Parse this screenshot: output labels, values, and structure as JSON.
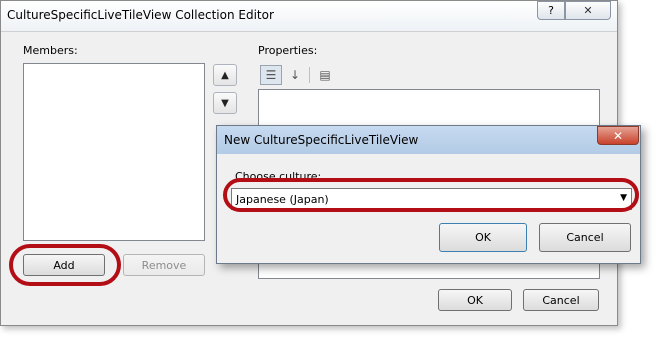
{
  "editor": {
    "title": "CultureSpecificLiveTileView Collection Editor",
    "help_glyph": "?",
    "close_glyph": "✕",
    "members_label": "Members:",
    "properties_label": "Properties:",
    "move_up_glyph": "▲",
    "move_down_glyph": "▼",
    "toolbar": {
      "categorized_glyph": "☰",
      "alphabetical_glyph": "↓",
      "property_pages_glyph": "▤"
    },
    "add_label": "Add",
    "remove_label": "Remove",
    "ok_label": "OK",
    "cancel_label": "Cancel"
  },
  "dialog": {
    "title": "New CultureSpecificLiveTileView",
    "close_glyph": "✕",
    "choose_label": "Choose culture:",
    "culture_value": "Japanese (Japan)",
    "dropdown_glyph": "▼",
    "ok_label": "OK",
    "cancel_label": "Cancel"
  },
  "colors": {
    "annotation": "#b30d16",
    "close_button": "#c8412b",
    "dialog_titlebar": "#b3cbe6"
  }
}
